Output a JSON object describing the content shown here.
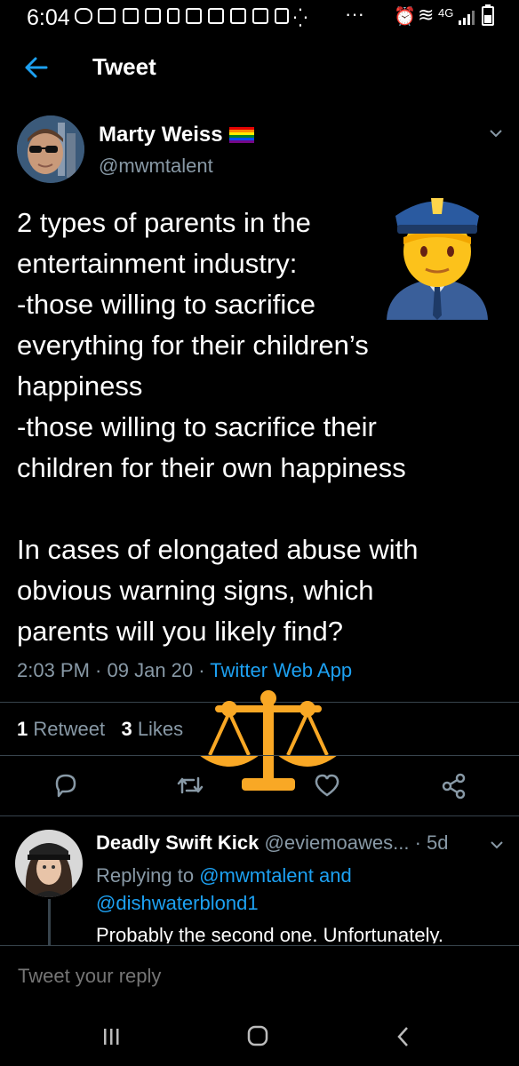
{
  "status_bar": {
    "time": "6:04",
    "network": "4G"
  },
  "header": {
    "title": "Tweet"
  },
  "tweet": {
    "author_name": "Marty Weiss",
    "author_handle": "@mwmtalent",
    "text": "2 types of parents in the\nentertainment industry:\n-those willing to sacrifice\neverything for their children’s\nhappiness\n-those willing to sacrifice their\nchildren for their own happiness\n\nIn cases of elongated abuse with\nobvious warning signs, which\nparents will you likely find?",
    "time": "2:03 PM",
    "date": "09 Jan 20",
    "source": "Twitter Web App",
    "retweet_count": "1",
    "retweet_label": "Retweet",
    "like_count": "3",
    "like_label": "Likes"
  },
  "reply": {
    "name": "Deadly Swift Kick",
    "handle": "@eviemoawes...",
    "age": "5d",
    "replying_prefix": "Replying to",
    "replying_user1": "@mwmtalent",
    "replying_and": "and",
    "replying_user2": "@dishwaterblond1",
    "text": "Probably the second one. Unfortunately."
  },
  "compose": {
    "placeholder": "Tweet your reply"
  },
  "colors": {
    "background": "#000000",
    "accent": "#1da1f2",
    "secondary_text": "#8899a6",
    "divider": "#38444d"
  }
}
